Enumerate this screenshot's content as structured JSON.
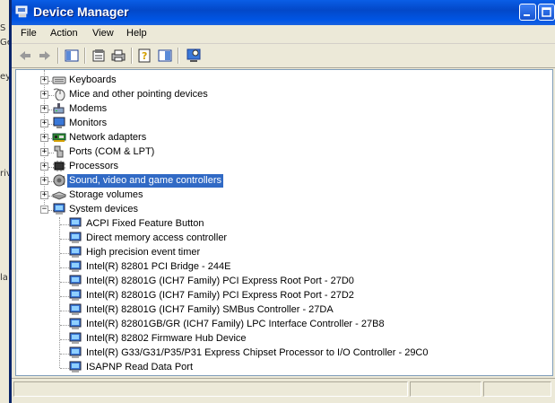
{
  "window": {
    "title": "Device Manager"
  },
  "desktop_fragments": [
    "S",
    "Ge",
    "ey",
    "rivi",
    "la"
  ],
  "menu": [
    "File",
    "Action",
    "View",
    "Help"
  ],
  "toolbar": {
    "buttons": [
      "back-icon",
      "forward-icon",
      "show-hide-tree-icon",
      "properties-icon",
      "print-icon",
      "help-icon",
      "console-tree-icon",
      "scan-hardware-icon"
    ]
  },
  "tree": {
    "categories": [
      {
        "label": "Keyboards",
        "icon": "keyboard-icon",
        "expanded": false,
        "selected": false
      },
      {
        "label": "Mice and other pointing devices",
        "icon": "mouse-icon",
        "expanded": false,
        "selected": false
      },
      {
        "label": "Modems",
        "icon": "modem-icon",
        "expanded": false,
        "selected": false
      },
      {
        "label": "Monitors",
        "icon": "monitor-icon",
        "expanded": false,
        "selected": false
      },
      {
        "label": "Network adapters",
        "icon": "network-adapter-icon",
        "expanded": false,
        "selected": false
      },
      {
        "label": "Ports (COM & LPT)",
        "icon": "port-icon",
        "expanded": false,
        "selected": false
      },
      {
        "label": "Processors",
        "icon": "processor-icon",
        "expanded": false,
        "selected": false
      },
      {
        "label": "Sound, video and game controllers",
        "icon": "sound-icon",
        "expanded": false,
        "selected": true
      },
      {
        "label": "Storage volumes",
        "icon": "storage-icon",
        "expanded": false,
        "selected": false
      },
      {
        "label": "System devices",
        "icon": "system-device-icon",
        "expanded": true,
        "selected": false
      }
    ],
    "system_devices": [
      "ACPI Fixed Feature Button",
      "Direct memory access controller",
      "High precision event timer",
      "Intel(R) 82801 PCI Bridge - 244E",
      "Intel(R) 82801G (ICH7 Family) PCI Express Root Port - 27D0",
      "Intel(R) 82801G (ICH7 Family) PCI Express Root Port - 27D2",
      "Intel(R) 82801G (ICH7 Family) SMBus Controller - 27DA",
      "Intel(R) 82801GB/GR (ICH7 Family) LPC Interface Controller - 27B8",
      "Intel(R) 82802 Firmware Hub Device",
      "Intel(R) G33/G31/P35/P31 Express Chipset Processor to I/O Controller - 29C0",
      "ISAPNP Read Data Port"
    ]
  },
  "colors": {
    "titlebar": "#0055e5",
    "selection": "#316ac5",
    "chrome": "#ece9d8"
  }
}
